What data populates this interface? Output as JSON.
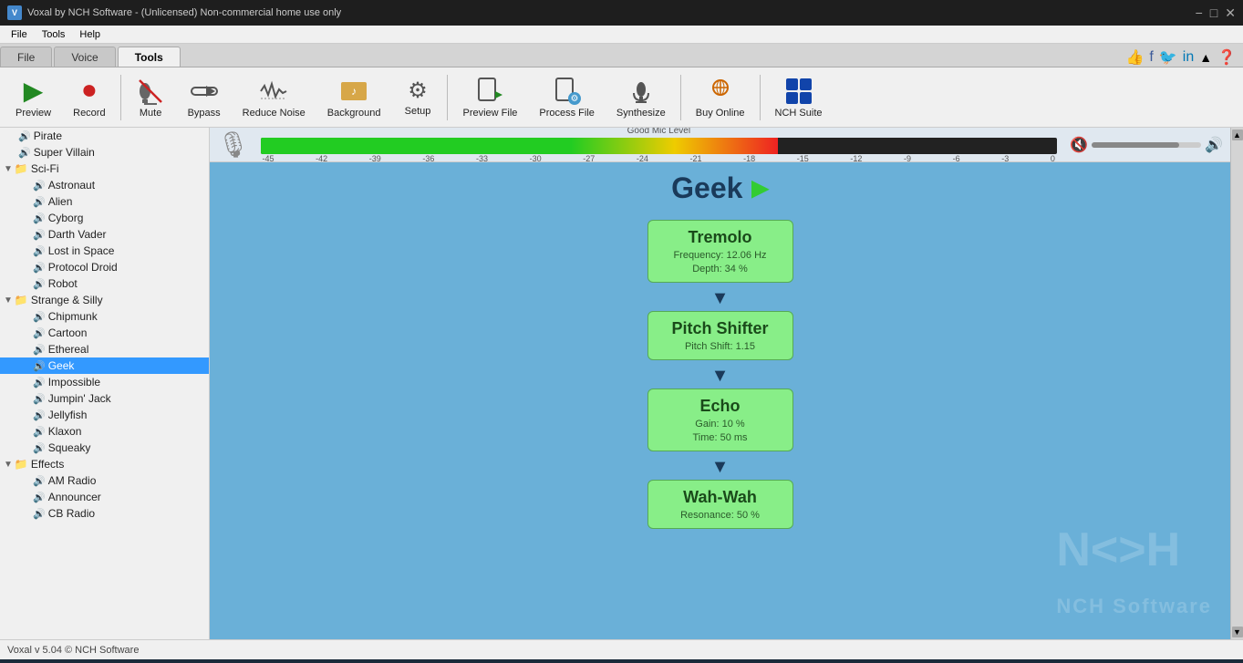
{
  "titleBar": {
    "title": "Voxal by NCH Software - (Unlicensed) Non-commercial home use only",
    "logo": "V"
  },
  "menuBar": {
    "items": [
      "File",
      "Tools",
      "Help"
    ]
  },
  "tabs": [
    {
      "label": "File",
      "id": "file"
    },
    {
      "label": "Voice",
      "id": "voice"
    },
    {
      "label": "Tools",
      "id": "tools",
      "active": true
    }
  ],
  "toolbar": {
    "buttons": [
      {
        "id": "preview",
        "label": "Preview",
        "icon": "▶",
        "iconColor": "#228822"
      },
      {
        "id": "record",
        "label": "Record",
        "icon": "⏺",
        "iconColor": "#cc2222"
      },
      {
        "id": "mute",
        "label": "Mute",
        "icon": "🔇",
        "iconColor": "#666"
      },
      {
        "id": "bypass",
        "label": "Bypass",
        "icon": "⤳",
        "iconColor": "#666"
      },
      {
        "id": "reduce-noise",
        "label": "Reduce Noise",
        "icon": "〰",
        "iconColor": "#555"
      },
      {
        "id": "background",
        "label": "Background",
        "icon": "🎵",
        "iconColor": "#cc6600"
      },
      {
        "id": "setup",
        "label": "Setup",
        "icon": "⚙",
        "iconColor": "#555"
      },
      {
        "id": "preview-file",
        "label": "Preview File",
        "icon": "📄▶",
        "iconColor": "#555"
      },
      {
        "id": "process-file",
        "label": "Process File",
        "icon": "📄⚙",
        "iconColor": "#555"
      },
      {
        "id": "synthesize",
        "label": "Synthesize",
        "icon": "🎙",
        "iconColor": "#555"
      },
      {
        "id": "buy-online",
        "label": "Buy Online",
        "icon": "🛒",
        "iconColor": "#cc6600"
      },
      {
        "id": "nch-suite",
        "label": "NCH Suite",
        "icon": "🔧",
        "iconColor": "#1144aa"
      }
    ]
  },
  "sidebar": {
    "items": [
      {
        "type": "leaf",
        "label": "Pirate",
        "depth": 1,
        "id": "pirate"
      },
      {
        "type": "leaf",
        "label": "Super Villain",
        "depth": 1,
        "id": "super-villain"
      },
      {
        "type": "folder",
        "label": "Sci-Fi",
        "depth": 0,
        "expanded": true,
        "id": "sci-fi"
      },
      {
        "type": "leaf",
        "label": "Astronaut",
        "depth": 2,
        "id": "astronaut"
      },
      {
        "type": "leaf",
        "label": "Alien",
        "depth": 2,
        "id": "alien"
      },
      {
        "type": "leaf",
        "label": "Cyborg",
        "depth": 2,
        "id": "cyborg"
      },
      {
        "type": "leaf",
        "label": "Darth Vader",
        "depth": 2,
        "id": "darth-vader"
      },
      {
        "type": "leaf",
        "label": "Lost in Space",
        "depth": 2,
        "id": "lost-in-space"
      },
      {
        "type": "leaf",
        "label": "Protocol Droid",
        "depth": 2,
        "id": "protocol-droid"
      },
      {
        "type": "leaf",
        "label": "Robot",
        "depth": 2,
        "id": "robot"
      },
      {
        "type": "folder",
        "label": "Strange & Silly",
        "depth": 0,
        "expanded": true,
        "id": "strange-silly"
      },
      {
        "type": "leaf",
        "label": "Chipmunk",
        "depth": 2,
        "id": "chipmunk"
      },
      {
        "type": "leaf",
        "label": "Cartoon",
        "depth": 2,
        "id": "cartoon"
      },
      {
        "type": "leaf",
        "label": "Ethereal",
        "depth": 2,
        "id": "ethereal"
      },
      {
        "type": "leaf",
        "label": "Geek",
        "depth": 2,
        "id": "geek",
        "selected": true
      },
      {
        "type": "leaf",
        "label": "Impossible",
        "depth": 2,
        "id": "impossible"
      },
      {
        "type": "leaf",
        "label": "Jumpin' Jack",
        "depth": 2,
        "id": "jumpin-jack"
      },
      {
        "type": "leaf",
        "label": "Jellyfish",
        "depth": 2,
        "id": "jellyfish"
      },
      {
        "type": "leaf",
        "label": "Klaxon",
        "depth": 2,
        "id": "klaxon"
      },
      {
        "type": "leaf",
        "label": "Squeaky",
        "depth": 2,
        "id": "squeaky"
      },
      {
        "type": "folder",
        "label": "Effects",
        "depth": 0,
        "expanded": true,
        "id": "effects"
      },
      {
        "type": "leaf",
        "label": "AM Radio",
        "depth": 2,
        "id": "am-radio"
      },
      {
        "type": "leaf",
        "label": "Announcer",
        "depth": 2,
        "id": "announcer"
      },
      {
        "type": "leaf",
        "label": "CB Radio",
        "depth": 2,
        "id": "cb-radio"
      }
    ]
  },
  "micLevel": {
    "label": "Good Mic Level",
    "ticks": [
      "-45",
      "-42",
      "-39",
      "-36",
      "-33",
      "-30",
      "-27",
      "-24",
      "-21",
      "-18",
      "-15",
      "-12",
      "-9",
      "-6",
      "-3",
      "0"
    ],
    "fillPercent": 65
  },
  "selectedVoice": {
    "name": "Geek",
    "effects": [
      {
        "id": "tremolo",
        "title": "Tremolo",
        "params": [
          "Frequency: 12.06 Hz",
          "Depth: 34 %"
        ]
      },
      {
        "id": "pitch-shifter",
        "title": "Pitch Shifter",
        "params": [
          "Pitch Shift: 1.15"
        ]
      },
      {
        "id": "echo",
        "title": "Echo",
        "params": [
          "Gain: 10 %",
          "Time: 50 ms"
        ]
      },
      {
        "id": "wah-wah",
        "title": "Wah-Wah",
        "params": [
          "Resonance: 50 %"
        ]
      }
    ]
  },
  "statusBar": {
    "text": "Voxal v 5.04 © NCH Software"
  }
}
